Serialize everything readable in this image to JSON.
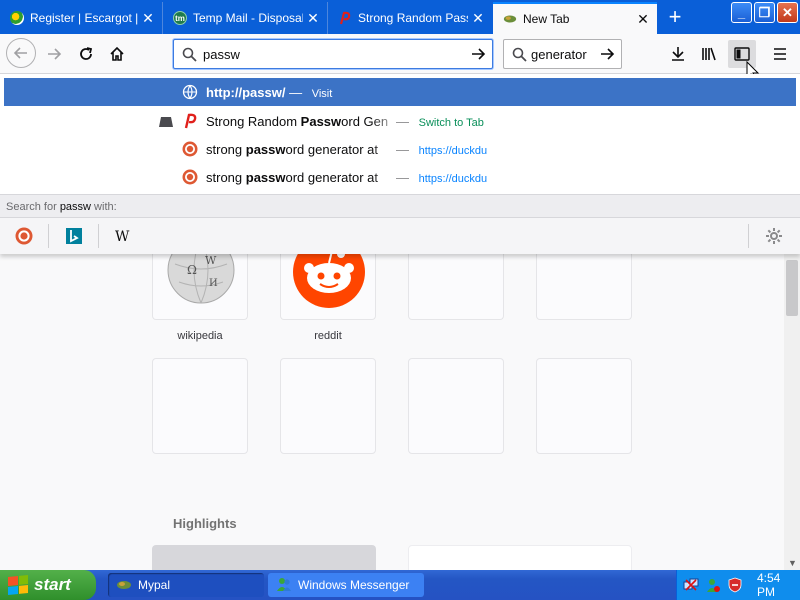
{
  "tabs": [
    {
      "title": "Register | Escargot | E",
      "close": "✕",
      "favicon": "escargot-icon"
    },
    {
      "title": "Temp Mail - Disposable",
      "close": "✕",
      "favicon": "tempmail-icon"
    },
    {
      "title": "Strong Random Passw",
      "close": "✕",
      "favicon": "password-generator-icon"
    },
    {
      "title": "New Tab",
      "close": "✕",
      "favicon": "new-tab-icon",
      "active": true
    }
  ],
  "new_tab_button": "+",
  "window_controls": {
    "minimize": "_",
    "maximize": "❐",
    "close": "✕"
  },
  "urlbar": {
    "value": "passw"
  },
  "searchbar": {
    "value": "generator"
  },
  "suggestions": [
    {
      "url": "http://passw/",
      "dash": "—",
      "action": "Visit",
      "icon": "globe-icon",
      "selected": true
    },
    {
      "prefix": "Strong Random ",
      "bold": "Passw",
      "suffix": "ord Gen",
      "dash": "—",
      "action": "Switch to Tab",
      "icon": "password-generator-icon"
    },
    {
      "prefix": "strong ",
      "bold": "passw",
      "suffix": "ord generator at",
      "dash": "—",
      "action": "https://duckdu",
      "icon": "duckduckgo-icon"
    },
    {
      "prefix": "strong ",
      "bold": "passw",
      "suffix": "ord generator at",
      "dash": "—",
      "action": "https://duckdu",
      "icon": "duckduckgo-icon"
    }
  ],
  "search_for": {
    "prefix": "Search for ",
    "term": "passw",
    "suffix": " with:"
  },
  "search_engines": [
    "duckduckgo-icon",
    "bing-icon",
    "wikipedia-icon"
  ],
  "top_sites": [
    {
      "label": "wikipedia"
    },
    {
      "label": "reddit"
    }
  ],
  "highlights_title": "Highlights",
  "taskbar": {
    "start_label": "start",
    "buttons": [
      {
        "label": "Mypal"
      },
      {
        "label": "Windows Messenger"
      }
    ],
    "clock": "4:54 PM"
  },
  "colors": {
    "tabstrip": "#0a5fd8",
    "selected_suggestion": "#3c73c6",
    "accent": "#0a84ff",
    "reddit": "#ff4500"
  }
}
